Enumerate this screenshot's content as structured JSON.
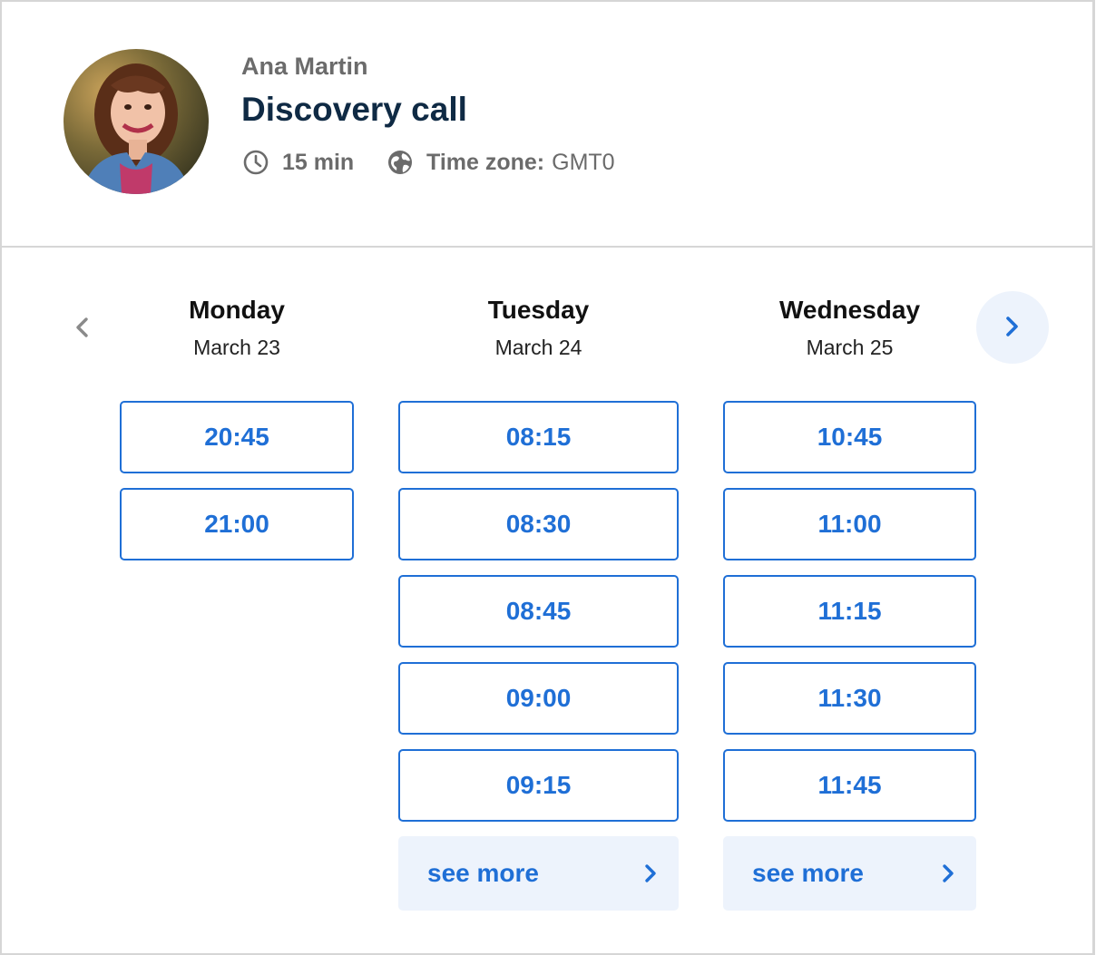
{
  "header": {
    "host_name": "Ana Martin",
    "event_title": "Discovery call",
    "duration": "15 min",
    "timezone_label": "Time zone:",
    "timezone_value": "GMT0",
    "icons": {
      "duration": "clock-icon",
      "timezone": "globe-icon",
      "avatar": "host-photo"
    }
  },
  "navigation": {
    "prev_icon": "chevron-left-icon",
    "next_icon": "chevron-right-icon"
  },
  "days": [
    {
      "name": "Monday",
      "date": "March 23",
      "slots": [
        "20:45",
        "21:00"
      ]
    },
    {
      "name": "Tuesday",
      "date": "March 24",
      "slots": [
        "08:15",
        "08:30",
        "08:45",
        "09:00",
        "09:15"
      ],
      "see_more": "see more"
    },
    {
      "name": "Wednesday",
      "date": "March 25",
      "slots": [
        "10:45",
        "11:00",
        "11:15",
        "11:30",
        "11:45"
      ],
      "see_more": "see more"
    }
  ],
  "colors": {
    "accent": "#1f6fd6",
    "accent_bg": "#edf3fc",
    "title": "#0f2a44",
    "muted": "#6b6b6b",
    "border": "#d6d6d6"
  }
}
